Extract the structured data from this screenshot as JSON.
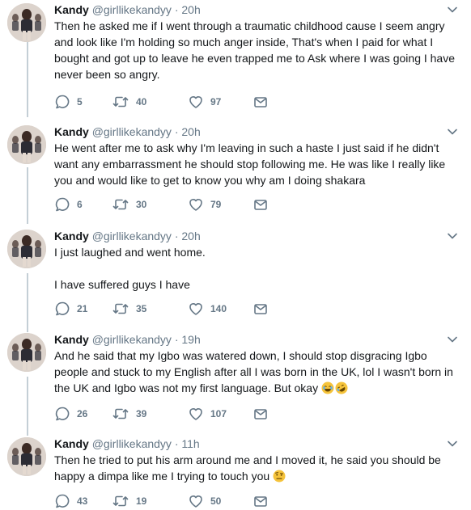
{
  "tweets": [
    {
      "name": "Kandy",
      "handle": "@girllikekandyy",
      "time": "20h",
      "paragraphs": [
        "Then he asked me if I went through a traumatic childhood cause I seem angry and look like I'm holding so much anger inside, That's when I paid for what I bought and got up to leave he even trapped me to Ask where I was going I have never been so angry."
      ],
      "replies": "5",
      "retweets": "40",
      "likes": "97"
    },
    {
      "name": "Kandy",
      "handle": "@girllikekandyy",
      "time": "20h",
      "paragraphs": [
        "He went after me to ask why I'm leaving in such a haste I just said if he didn't want any embarrassment he should stop following me.  He was like I really like you and would like to get to know you why am I doing shakara"
      ],
      "replies": "6",
      "retweets": "30",
      "likes": "79"
    },
    {
      "name": "Kandy",
      "handle": "@girllikekandyy",
      "time": "20h",
      "paragraphs": [
        "I just laughed and went home.",
        "I have suffered guys I have"
      ],
      "replies": "21",
      "retweets": "35",
      "likes": "140"
    },
    {
      "name": "Kandy",
      "handle": "@girllikekandyy",
      "time": "19h",
      "paragraphs": [
        "And he said that my Igbo was watered down, I should stop disgracing Igbo people and stuck to my English after all I was born in the UK, lol I wasn't born in the UK and Igbo was not my first language. But okay"
      ],
      "emojis": [
        "joy-emoji",
        "rofl-emoji"
      ],
      "replies": "26",
      "retweets": "39",
      "likes": "107"
    },
    {
      "name": "Kandy",
      "handle": "@girllikekandyy",
      "time": "11h",
      "paragraphs": [
        "Then he tried to put his arm around me and I moved it, he said you should be happy a dimpa like me I trying to touch you"
      ],
      "emojis": [
        "raised-eyebrow-emoji"
      ],
      "replies": "43",
      "retweets": "19",
      "likes": "50"
    }
  ],
  "separator": "·",
  "colors": {
    "secondary": "#657786",
    "text": "#14171a",
    "thread_line": "#c4cfd6",
    "emoji": "#f5c33b"
  },
  "icons": {
    "reply": "reply-icon",
    "retweet": "retweet-icon",
    "like": "heart-icon",
    "dm": "envelope-icon",
    "more": "chevron-down-icon"
  }
}
